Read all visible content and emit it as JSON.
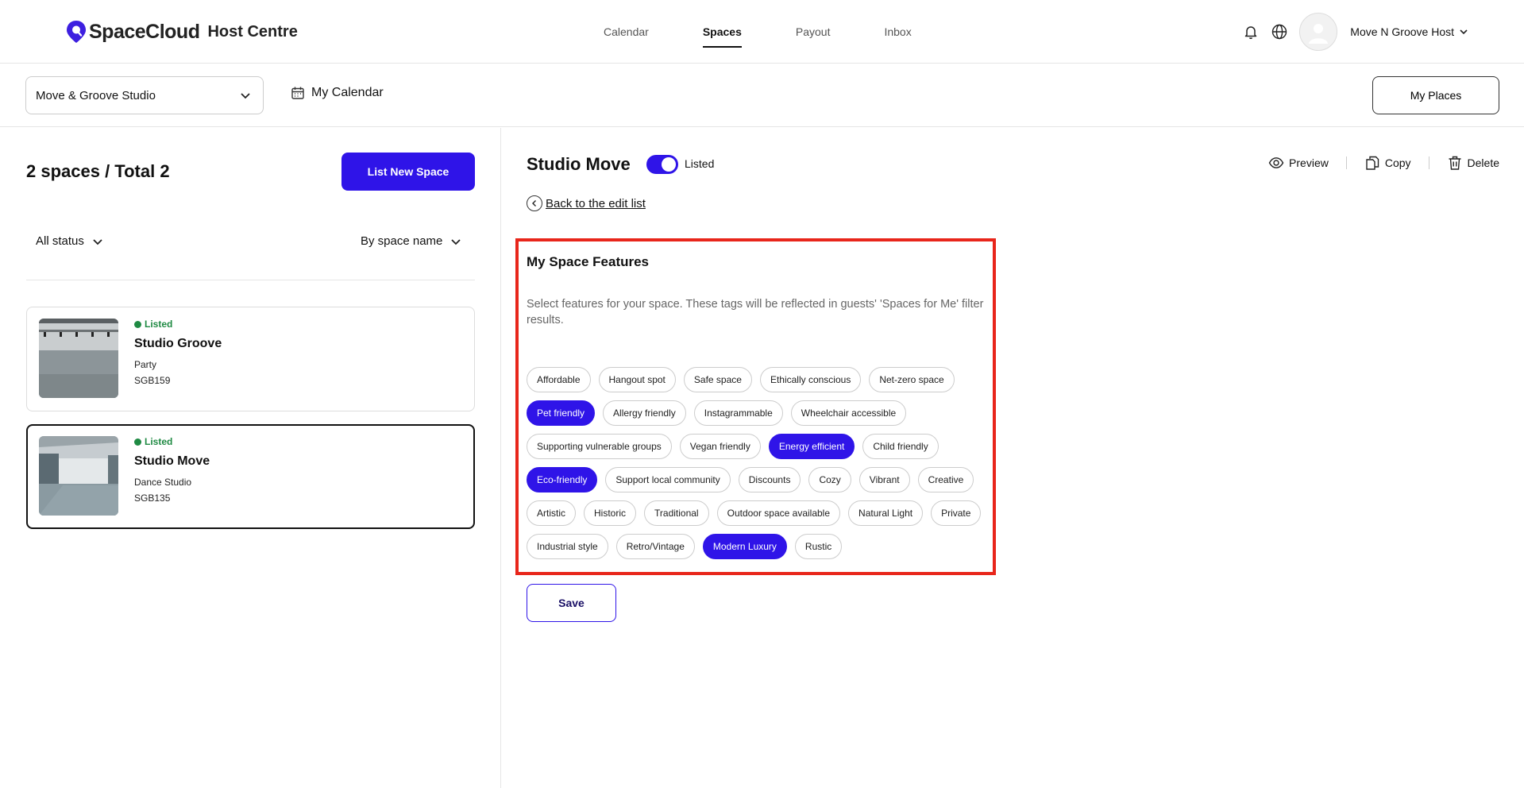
{
  "brand": {
    "name": "SpaceCloud",
    "sub": "Host Centre"
  },
  "nav": {
    "items": [
      "Calendar",
      "Spaces",
      "Payout",
      "Inbox"
    ],
    "active": "Spaces"
  },
  "user": {
    "name": "Move N Groove Host"
  },
  "subbar": {
    "studio": "Move & Groove Studio",
    "calendar": "My Calendar",
    "my_places": "My Places"
  },
  "left": {
    "count": "2 spaces / Total 2",
    "list_new": "List New Space",
    "filter_status": "All status",
    "filter_sort": "By space name",
    "spaces": [
      {
        "status": "Listed",
        "name": "Studio Groove",
        "type": "Party",
        "code": "SGB159"
      },
      {
        "status": "Listed",
        "name": "Studio Move",
        "type": "Dance Studio",
        "code": "SGB135"
      }
    ]
  },
  "detail": {
    "title": "Studio Move",
    "listed_label": "Listed",
    "listed": true,
    "preview": "Preview",
    "copy": "Copy",
    "delete": "Delete",
    "back": "Back to the edit list",
    "features_title": "My Space Features",
    "features_desc": "Select features for your space. These tags will be reflected in guests' 'Spaces for Me' filter results.",
    "tags": [
      [
        "Affordable",
        "Hangout spot",
        "Safe space",
        "Ethically conscious",
        "Net-zero space"
      ],
      [
        "Pet friendly",
        "Allergy friendly",
        "Instagrammable",
        "Wheelchair accessible"
      ],
      [
        "Supporting vulnerable groups",
        "Vegan friendly",
        "Energy efficient",
        "Child friendly"
      ],
      [
        "Eco-friendly",
        "Support local community",
        "Discounts",
        "Cozy",
        "Vibrant",
        "Creative"
      ],
      [
        "Artistic",
        "Historic",
        "Traditional",
        "Outdoor space available",
        "Natural Light",
        "Private"
      ],
      [
        "Industrial style",
        "Retro/Vintage",
        "Modern Luxury",
        "Rustic"
      ]
    ],
    "selected_tags": [
      "Pet friendly",
      "Energy efficient",
      "Eco-friendly",
      "Modern Luxury"
    ],
    "save": "Save"
  },
  "colors": {
    "accent": "#2f14e8",
    "listed": "#1f8a43",
    "highlight": "#e8261b"
  }
}
